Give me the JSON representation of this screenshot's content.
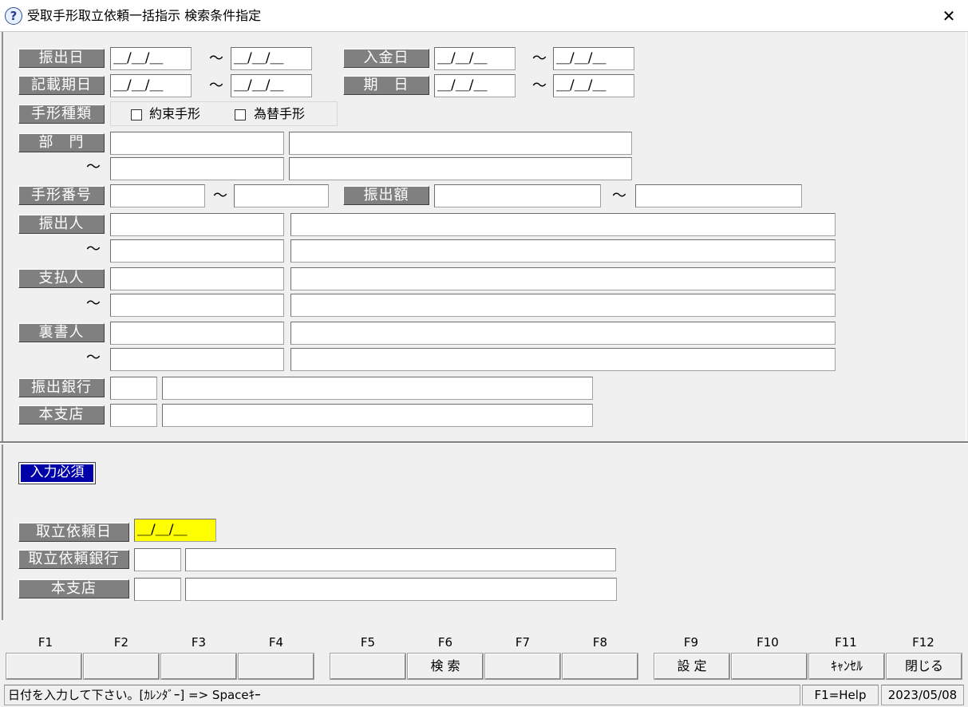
{
  "window": {
    "title": "受取手形取立依頼一括指示 検索条件指定",
    "help_icon": "?",
    "close": "✕"
  },
  "labels": {
    "furidashi_bi": "振出日",
    "nyukin_bi": "入金日",
    "kisai_kijitsu": "記載期日",
    "kijitsu": "期　日",
    "tegata_shurui": "手形種類",
    "bumon": "部　門",
    "tegata_bango": "手形番号",
    "furidashi_gaku": "振出額",
    "furidashi_nin": "振出人",
    "shiharai_nin": "支払人",
    "uragaki_nin": "裏書人",
    "furidashi_ginko": "振出銀行",
    "honshiten": "本支店",
    "required": "入力必須",
    "toritate_irai_bi": "取立依頼日",
    "toritate_irai_ginko": "取立依頼銀行",
    "honshiten2": "本支店"
  },
  "tilde": "〜",
  "date_placeholder": "＿/＿/＿",
  "checkboxes": {
    "yakusoku": "約束手形",
    "kawase": "為替手形"
  },
  "fkeys": [
    "F1",
    "F2",
    "F3",
    "F4",
    "F5",
    "F6",
    "F7",
    "F8",
    "F9",
    "F10",
    "F11",
    "F12"
  ],
  "fbuttons": [
    "",
    "",
    "",
    "",
    "",
    "検 索",
    "",
    "",
    "設 定",
    "",
    "ｷｬﾝｾﾙ",
    "閉じる"
  ],
  "status": {
    "message": "日付を入力して下さい。[ｶﾚﾝﾀﾞｰ] => Spaceｷｰ",
    "help": "F1=Help",
    "date": "2023/05/08"
  },
  "colors": {
    "label_bg": "#808080",
    "required_bg": "#0000a8",
    "highlight": "#ffff00"
  }
}
